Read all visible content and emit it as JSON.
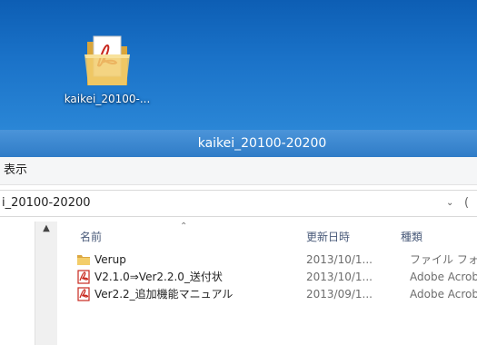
{
  "desktop": {
    "icon": {
      "label": "kaikei_20100-...",
      "icon_name": "pdf-folder-icon"
    },
    "background_color": "#1a72c8"
  },
  "window": {
    "title": "kaikei_20100-20200",
    "menu": {
      "view_label": "表示"
    },
    "address": {
      "text": "i_20100-20200",
      "dropdown_glyph": "⌄",
      "refresh_glyph": "("
    },
    "nav": {
      "scroll_up_glyph": "▲"
    },
    "columns": {
      "name": "名前",
      "modified": "更新日時",
      "type": "種類",
      "sort_glyph": "⌃"
    },
    "files": [
      {
        "name": "Verup",
        "modified": "2013/10/1...",
        "type": "ファイル フォルダー",
        "icon": "folder-icon"
      },
      {
        "name": "V2.1.0⇒Ver2.2.0_送付状",
        "modified": "2013/10/1...",
        "type": "Adobe Acrobat",
        "icon": "pdf-icon"
      },
      {
        "name": "Ver2.2_追加機能マニュアル",
        "modified": "2013/09/1...",
        "type": "Adobe Acrobat",
        "icon": "pdf-icon"
      }
    ]
  },
  "colors": {
    "titlebar": "#2f7cc7",
    "pdf_red": "#c8281e",
    "folder_yellow": "#e8b84a"
  }
}
